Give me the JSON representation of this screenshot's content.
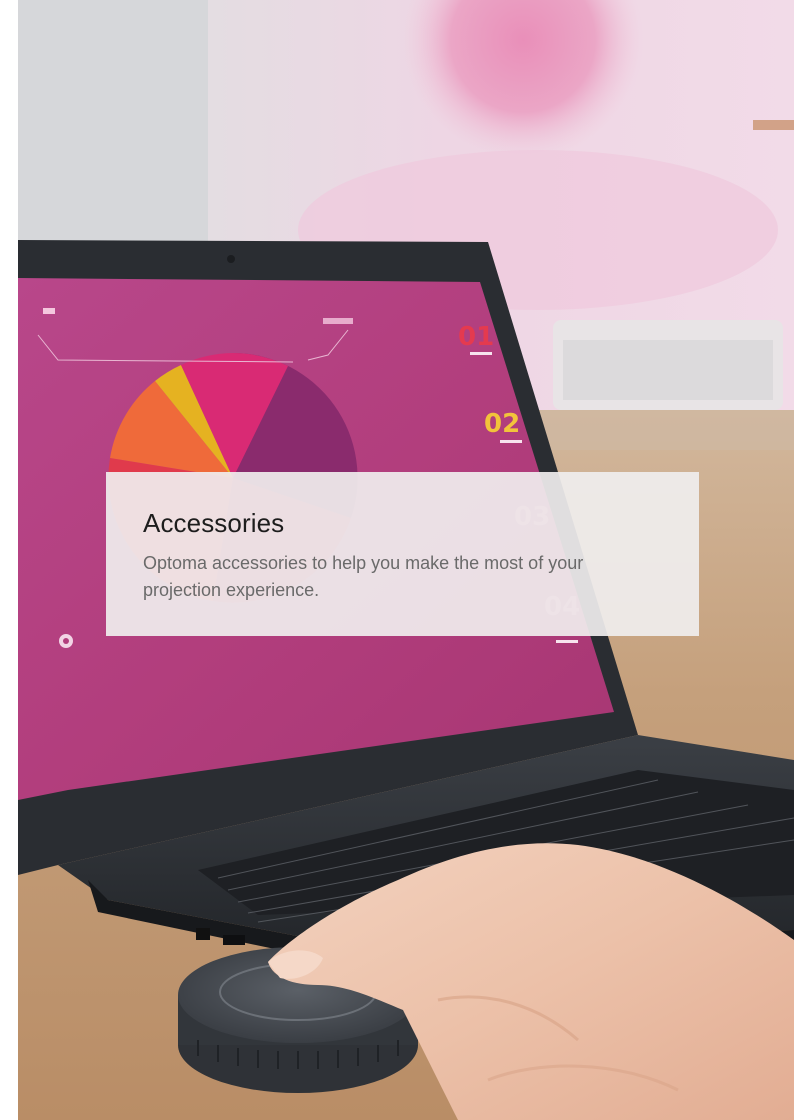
{
  "hero": {
    "title": "Accessories",
    "description": "Optoma accessories to help you make the most of your projection experience."
  },
  "laptop_screen": {
    "labels": [
      "01",
      "02",
      "03",
      "04"
    ]
  },
  "colors": {
    "screen": "#b5407e",
    "pie_red": "#e03a4c",
    "pie_orange": "#ef6a3a",
    "pie_yellow": "#e5b221",
    "pie_magenta": "#d92a74",
    "pie_purple": "#8a2b6d",
    "desk": "#c29974",
    "background_wall": "#efd8e6"
  }
}
